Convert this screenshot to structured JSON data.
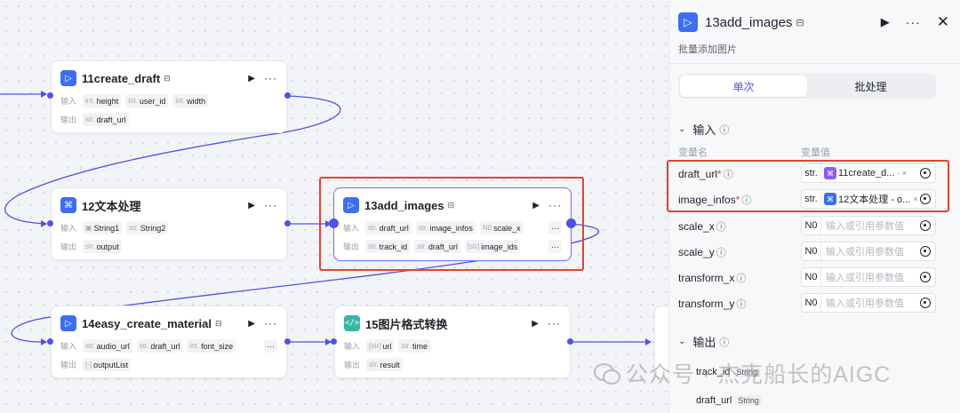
{
  "nodes": {
    "create_draft": {
      "title": "11create_draft",
      "input_label": "输入",
      "output_label": "输出",
      "inputs": [
        {
          "type": "int.",
          "name": "height"
        },
        {
          "type": "int.",
          "name": "user_id"
        },
        {
          "type": "int.",
          "name": "width"
        }
      ],
      "outputs": [
        {
          "type": "str.",
          "name": "draft_url"
        }
      ]
    },
    "text_process": {
      "title": "12文本处理",
      "input_label": "输入",
      "output_label": "输出",
      "inputs": [
        {
          "type": "",
          "name": "String1"
        },
        {
          "type": "str.",
          "name": "String2"
        }
      ],
      "outputs": [
        {
          "type": "str.",
          "name": "output"
        }
      ]
    },
    "add_images": {
      "title": "13add_images",
      "input_label": "输入",
      "output_label": "输出",
      "inputs": [
        {
          "type": "str.",
          "name": "draft_url"
        },
        {
          "type": "str.",
          "name": "image_infos"
        },
        {
          "type": "N0",
          "name": "scale_x"
        }
      ],
      "outputs": [
        {
          "type": "str.",
          "name": "track_id"
        },
        {
          "type": "str.",
          "name": "draft_url"
        },
        {
          "type": "[str]",
          "name": "image_ids"
        }
      ]
    },
    "easy_create_material": {
      "title": "14easy_create_material",
      "input_label": "输入",
      "output_label": "输出",
      "inputs": [
        {
          "type": "str.",
          "name": "audio_url"
        },
        {
          "type": "str.",
          "name": "draft_url"
        },
        {
          "type": "int.",
          "name": "font_size"
        }
      ],
      "outputs": [
        {
          "type": "[-]",
          "name": "outputList"
        }
      ]
    },
    "image_convert": {
      "title": "15图片格式转换",
      "input_label": "输入",
      "output_label": "输出",
      "inputs": [
        {
          "type": "[str]",
          "name": "url"
        },
        {
          "type": "str.",
          "name": "time"
        }
      ],
      "outputs": [
        {
          "type": "str.",
          "name": "result"
        }
      ]
    }
  },
  "panel": {
    "title": "13add_images",
    "description": "批量添加图片",
    "modes": [
      "单次",
      "批处理"
    ],
    "active_mode": "单次",
    "input_section": "输入",
    "col_name": "变量名",
    "col_value": "变量值",
    "params": [
      {
        "name": "draft_url",
        "required": "*",
        "type": "str.",
        "ref_node": "11create_d...",
        "ref_suffix": "- ×",
        "ref_icon": "bot-icon",
        "ref_color": "#8b5cf6"
      },
      {
        "name": "image_infos",
        "required": "*",
        "type": "str.",
        "ref_node": "12文本处理 - o...",
        "ref_suffix": "×",
        "ref_icon": "bot-icon",
        "ref_color": "#3b6ef2"
      },
      {
        "name": "scale_x",
        "type": "N0",
        "placeholder": "输入或引用参数值"
      },
      {
        "name": "scale_y",
        "type": "N0",
        "placeholder": "输入或引用参数值"
      },
      {
        "name": "transform_x",
        "type": "N0",
        "placeholder": "输入或引用参数值"
      },
      {
        "name": "transform_y",
        "type": "N0",
        "placeholder": "输入或引用参数值"
      }
    ],
    "output_section": "输出",
    "outputs": [
      {
        "name": "track_id",
        "type": "String"
      },
      {
        "name": "draft_url",
        "type": "String"
      }
    ]
  },
  "watermark": "公众号 · 杰克船长的AIGC",
  "colors": {
    "accent": "#4d53e8",
    "highlight": "#e8412c",
    "edge": "#4d53e8"
  }
}
